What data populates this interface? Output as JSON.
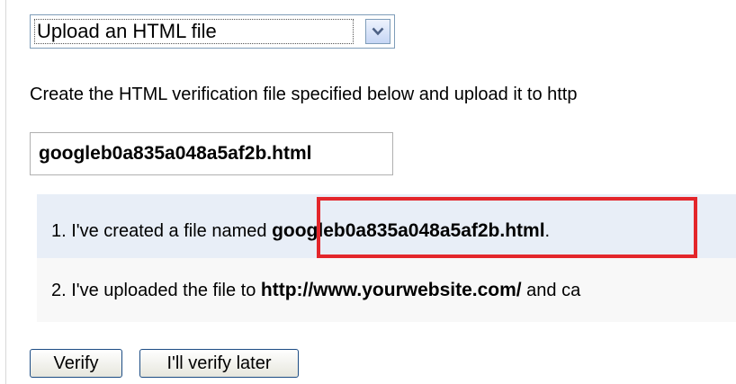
{
  "method_select": {
    "selected": "Upload an HTML file"
  },
  "instruction_text": "Create the HTML verification file specified below and upload it to http",
  "verification_filename": "googleb0a835a048a5af2b.html",
  "steps": [
    {
      "prefix": "1. I've created a file named ",
      "filename": "googleb0a835a048a5af2b.html",
      "suffix": "."
    },
    {
      "prefix": "2. I've uploaded the file to ",
      "url": "http://www.yourwebsite.com/",
      "suffix": " and ca"
    }
  ],
  "buttons": {
    "verify": "Verify",
    "verify_later": "I'll verify later"
  },
  "colors": {
    "highlight": "#e3262b",
    "step_one_bg": "#e8eef7",
    "step_two_bg": "#f8f8f8"
  },
  "icons": {
    "dropdown": "chevron-down-icon"
  }
}
